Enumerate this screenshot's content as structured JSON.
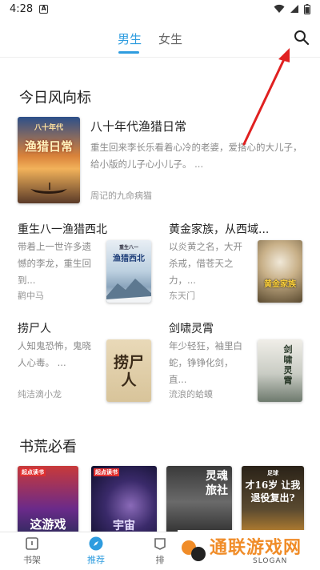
{
  "status_bar": {
    "time": "4:28",
    "app_indicator": "A"
  },
  "tabs": [
    {
      "label": "男生",
      "active": true
    },
    {
      "label": "女生",
      "active": false
    }
  ],
  "search_icon": "search-icon",
  "section1": {
    "title": "今日风向标",
    "featured": {
      "title": "八十年代渔猎日常",
      "desc": "重生回来李长乐看着心冷的老婆，爱搭心的大儿子，给小版的儿子心小儿子。 ...",
      "author": "周记的九命病猫",
      "cover_text": "渔猎日常",
      "cover_top": "八十年代"
    },
    "books": [
      {
        "title": "重生八一渔猎西北",
        "desc": "带着上一世许多遗憾的李龙，重生回到...",
        "author": "鹳中马",
        "cover_text": "渔猎西北",
        "cover_top": "重生八一"
      },
      {
        "title": "黄金家族，从西域...",
        "desc": "以炎黄之名，大开杀戒，借苍天之力，...",
        "author": "东天门",
        "cover_text": "黄金家族"
      },
      {
        "title": "捞尸人",
        "desc": "人知鬼恐怖，鬼晓人心毒。 ...",
        "author": "纯洁滴小龙",
        "cover_text": "捞尸人"
      },
      {
        "title": "剑啸灵霄",
        "desc": "年少轻狂，袖里白蛇，铮铮化剑，直...",
        "author": "流浪的蛤蟆",
        "cover_text": "剑啸灵霄"
      }
    ]
  },
  "section2": {
    "title": "书荒必看",
    "covers": [
      {
        "text": "这游戏",
        "badge": "起点读书"
      },
      {
        "text": "宇宙",
        "badge": "起点读书"
      },
      {
        "text": "灵魂旅社",
        "badge": ""
      },
      {
        "text": "才16岁 让我退役复出?",
        "badge": "足球"
      }
    ]
  },
  "bottom_nav": [
    {
      "label": "书架",
      "icon": "bookshelf-icon",
      "active": false
    },
    {
      "label": "推荐",
      "icon": "compass-icon",
      "active": true
    },
    {
      "label": "排",
      "icon": "rank-icon",
      "active": false
    }
  ],
  "watermark": {
    "text": "通联游戏网",
    "slogan": "SLOGAN"
  },
  "colors": {
    "accent": "#2e9cdf",
    "arrow": "#e02020"
  }
}
